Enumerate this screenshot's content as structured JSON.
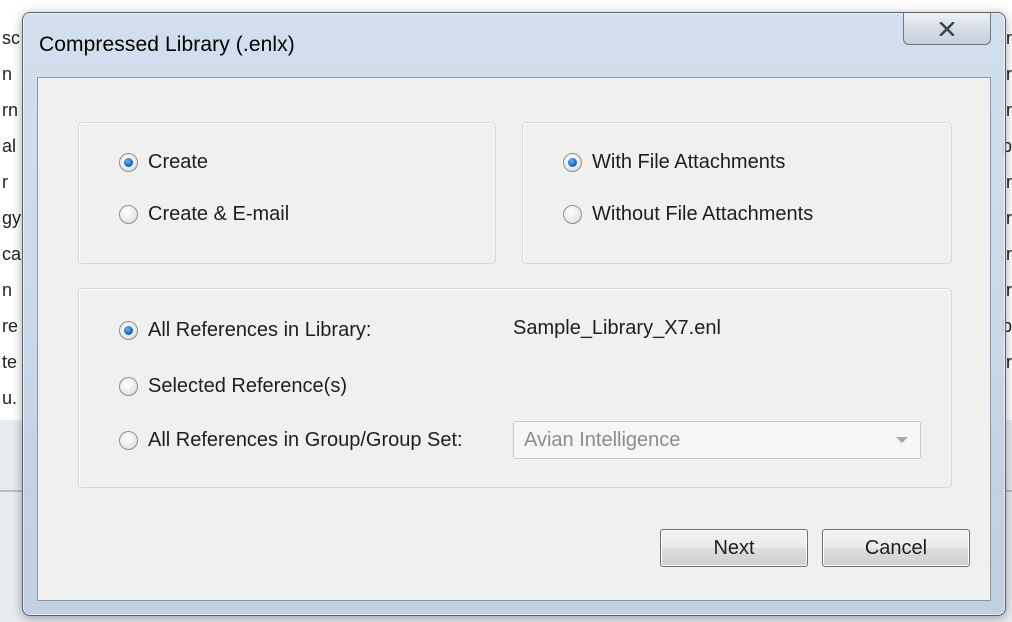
{
  "background": {
    "left_rows": [
      "sc",
      "n",
      "rn",
      "al",
      "r",
      "gy",
      "ca",
      "n",
      "re",
      "te",
      "u."
    ],
    "right_rows": [
      "r",
      "r",
      "r",
      "p",
      "r",
      "r",
      "r",
      "r",
      "b",
      "r"
    ]
  },
  "dialog": {
    "title": "Compressed Library (.enlx)",
    "close_glyph": "✕"
  },
  "create_group": {
    "options": [
      {
        "label": "Create",
        "selected": true
      },
      {
        "label": "Create & E-mail",
        "selected": false
      }
    ]
  },
  "attachments_group": {
    "options": [
      {
        "label": "With File Attachments",
        "selected": true
      },
      {
        "label": "Without File Attachments",
        "selected": false
      }
    ]
  },
  "references_group": {
    "options": [
      {
        "label": "All References in Library:",
        "selected": true
      },
      {
        "label": "Selected Reference(s)",
        "selected": false
      },
      {
        "label": "All References in Group/Group Set:",
        "selected": false
      }
    ],
    "library_file": "Sample_Library_X7.enl",
    "group_select": {
      "value": "Avian Intelligence",
      "disabled": true
    }
  },
  "buttons": {
    "next": "Next",
    "cancel": "Cancel"
  },
  "colors": {
    "radio_selected": "#1b6fc2",
    "dialog_frame": "#c8d6e6",
    "client_bg": "#f0f0f0"
  }
}
